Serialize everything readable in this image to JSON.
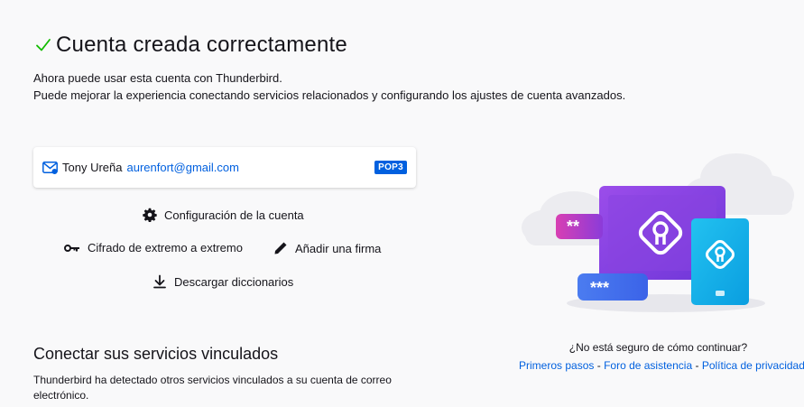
{
  "header": {
    "title": "Cuenta creada correctamente",
    "line1": "Ahora puede usar esta cuenta con Thunderbird.",
    "line2": "Puede mejorar la experiencia conectando servicios relacionados y configurando los ajustes de cuenta avanzados."
  },
  "account": {
    "name": "Tony Ureña",
    "email": "aurenfort@gmail.com",
    "type_badge": "POP3"
  },
  "actions": {
    "config": "Configuración de la cuenta",
    "e2e": "Cifrado de extremo a extremo",
    "signature": "Añadir una firma",
    "dictionaries": "Descargar diccionarios"
  },
  "linked": {
    "title": "Conectar sus servicios vinculados",
    "description": "Thunderbird ha detectado otros servicios vinculados a su cuenta de correo electrónico."
  },
  "help": {
    "question": "¿No está seguro de cómo continuar?",
    "link1": "Primeros pasos",
    "link2": "Foro de asistencia",
    "link3": "Política de privacidad",
    "separator": "-"
  },
  "illustration": {
    "pin_top": "**",
    "pin_bottom": "***"
  },
  "icons": {
    "success": "check-icon",
    "account": "mail-account-icon",
    "config": "gear-icon",
    "e2e": "key-icon",
    "signature": "pencil-icon",
    "dictionaries": "download-icon"
  },
  "colors": {
    "accent": "#0060df",
    "success": "#12bc00",
    "background": "#f9f9fa"
  }
}
